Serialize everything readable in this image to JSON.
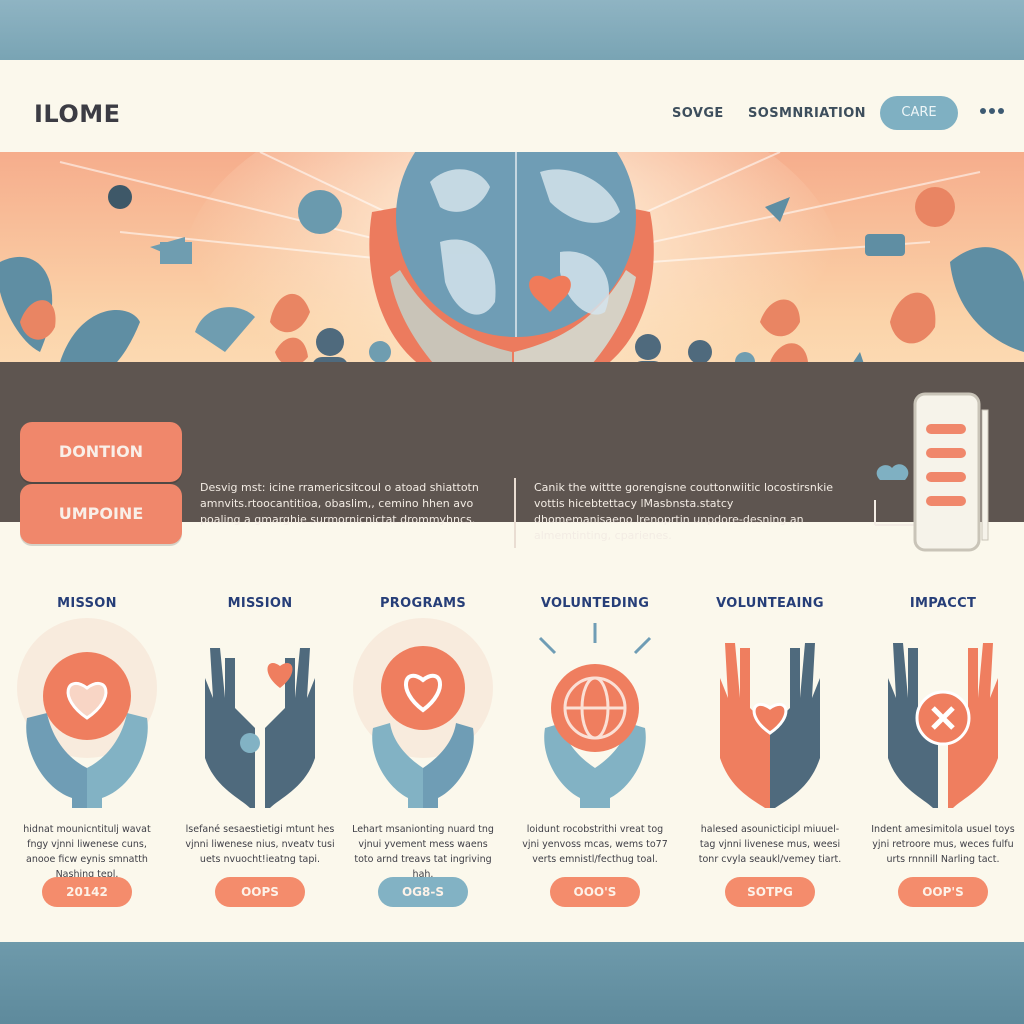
{
  "header": {
    "logo": "ILOME",
    "nav": [
      "SOVGE",
      "SOSMNRIATION"
    ],
    "care_button": "CARE"
  },
  "hero": {
    "buttons": [
      "DONTION",
      "UMPOINE"
    ],
    "text_left": "Desvig mst: icine rramericsitcoul o atoad shiattotn amnvits.rtoocantitioa, obaslim,, cemino hhen avo poaling a gmarghie surmornicnictat drommyhncs.",
    "text_right": "Canik the wittte gorengisne couttonwiitic locostirsnkie vottis hicebtettacy lMasbnsta.statcy dhomemanisaeno lrenoprtin unpdore-desning an almemtinting, cparienes."
  },
  "cards": [
    {
      "title": "MISSON",
      "text": "hidnat mounicntitulj wavat fngy vjnni liwenese cuns, anooe ficw eynis smnatth Nashing tepl.",
      "pill": "20142",
      "pill_color": "#f48c6c",
      "icon": "heart-ball-hands-icon"
    },
    {
      "title": "MISSION",
      "text": "lsefané sesaestietigi mtunt hes vjnni liwenese nius, nveatv tusi uets nvuocht!ieatng tapi.",
      "pill": "OOPS",
      "pill_color": "#f48c6c",
      "icon": "raised-hands-heart-icon"
    },
    {
      "title": "PROGRAMS",
      "text": "Lehart msanionting nuard tng vjnui yvement mess waens toto arnd treavs tat ingriving hah.",
      "pill": "OG8-S",
      "pill_color": "#82b2c4",
      "icon": "heart-circle-hands-icon"
    },
    {
      "title": "VOLUNTEDING",
      "text": "loidunt rocobstrithi vreat tog vjni yenvoss mcas, wems to77 verts emnistl/fecthug toal.",
      "pill": "OOO'S",
      "pill_color": "#f48c6c",
      "icon": "globe-hands-icon"
    },
    {
      "title": "VOLUNTEAING",
      "text": "halesed asounicticipl miuuel-tag vjnni livenese mus, weesi tonr cvyla seaukl/vemey tiart.",
      "pill": "SOTPG",
      "pill_color": "#f48c6c",
      "icon": "open-palm-heart-icon"
    },
    {
      "title": "IMPACCT",
      "text": "Indent amesimitola usuel toys yjni retroore mus, weces fulfu urts rnnnill Narling tact.",
      "pill": "OOP'S",
      "pill_color": "#f48c6c",
      "icon": "hands-star-icon"
    }
  ]
}
